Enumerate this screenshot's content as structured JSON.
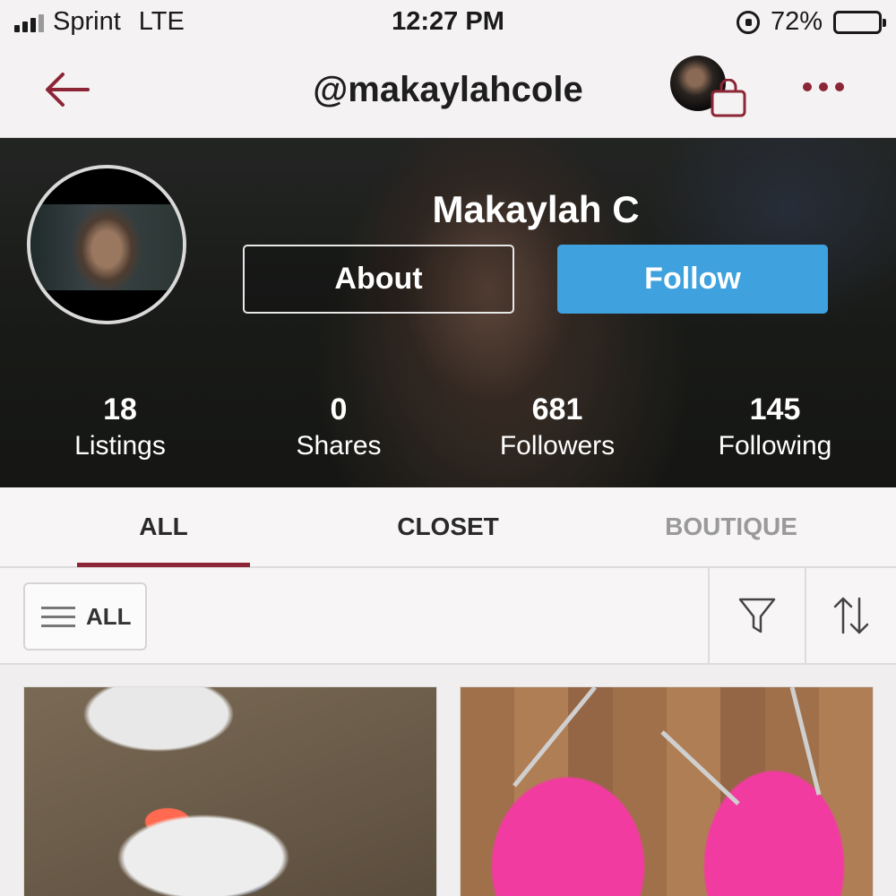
{
  "status_bar": {
    "carrier": "Sprint",
    "network": "LTE",
    "time": "12:27 PM",
    "battery": "72%",
    "battery_level": 0.72
  },
  "nav": {
    "title": "@makaylahcole",
    "back_icon": "back-arrow-icon",
    "bag_icon": "shopping-bag-icon",
    "more_icon": "more-dots-icon",
    "accent_color": "#8c2535"
  },
  "profile": {
    "name": "Makaylah C",
    "about_label": "About",
    "follow_label": "Follow",
    "follow_color": "#3fa1dd",
    "stats": [
      {
        "value": "18",
        "label": "Listings"
      },
      {
        "value": "0",
        "label": "Shares"
      },
      {
        "value": "681",
        "label": "Followers"
      },
      {
        "value": "145",
        "label": "Following"
      }
    ]
  },
  "tabs": [
    {
      "label": "ALL",
      "active": true
    },
    {
      "label": "CLOSET",
      "active": false
    },
    {
      "label": "BOUTIQUE",
      "active": false
    }
  ],
  "filters": {
    "category_label": "ALL",
    "menu_icon": "menu-icon",
    "filter_icon": "filter-funnel-icon",
    "sort_icon": "sort-arrows-icon"
  },
  "listings": [
    {
      "subject": "sneakers"
    },
    {
      "subject": "bikini-top"
    }
  ]
}
